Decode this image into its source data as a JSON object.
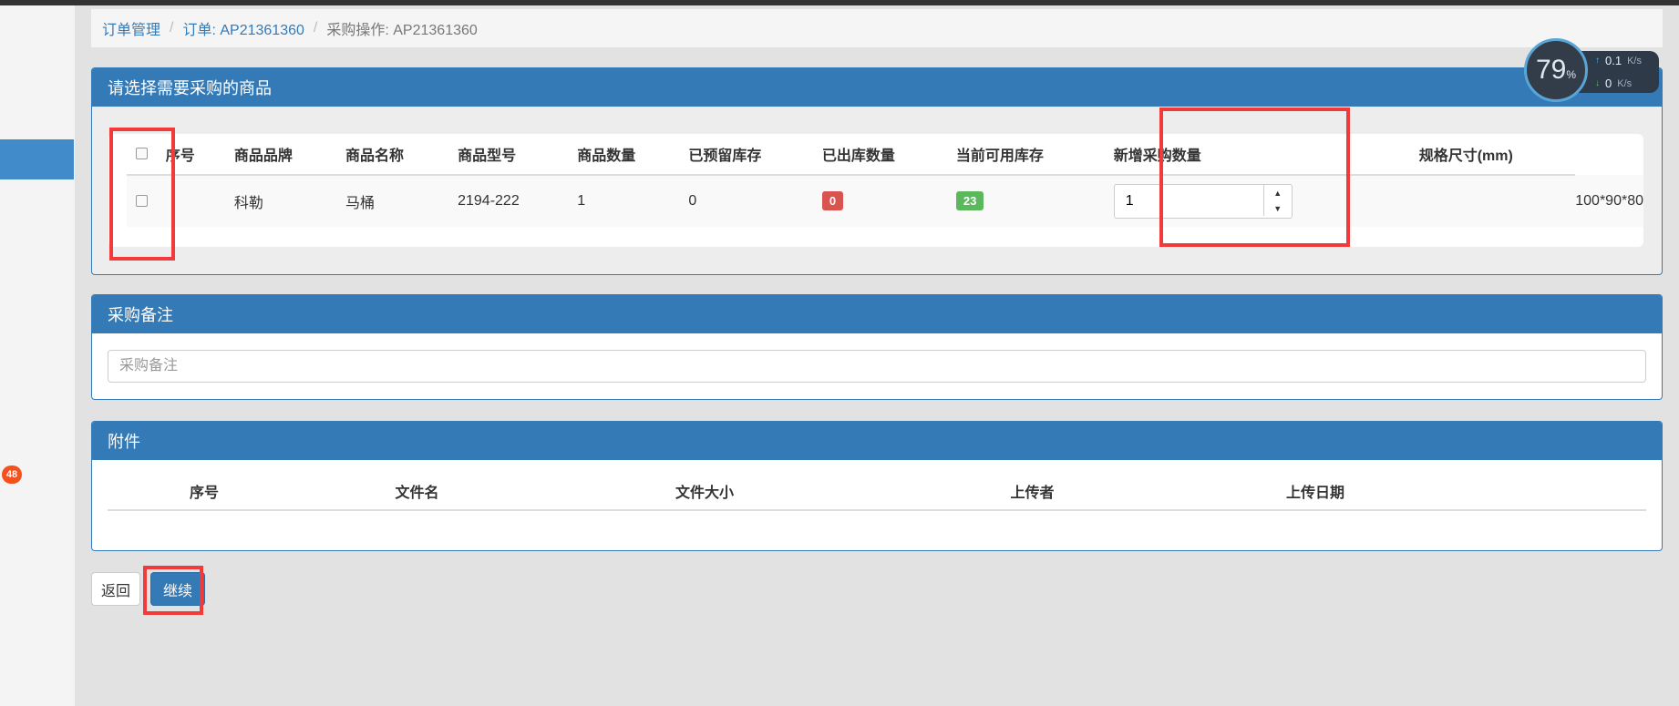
{
  "breadcrumb": {
    "items": [
      "订单管理",
      "订单: AP21361360"
    ],
    "separator": "/",
    "active": "采购操作: AP21361360"
  },
  "sidebar": {
    "badge": "48"
  },
  "goods_panel": {
    "title": "请选择需要采购的商品",
    "columns": [
      "序号",
      "商品品牌",
      "商品名称",
      "商品型号",
      "商品数量",
      "已预留库存",
      "已出库数量",
      "当前可用库存",
      "新增采购数量",
      "规格尺寸(mm)"
    ],
    "row": {
      "index": "",
      "brand": "科勒",
      "name": "马桶",
      "model": "2194-222",
      "quantity": "1",
      "reserved": "0",
      "shipped": "0",
      "available": "23",
      "new_purchase_qty": "1",
      "size": "100*90*80"
    }
  },
  "note_panel": {
    "title": "采购备注",
    "placeholder": "采购备注"
  },
  "attachments_panel": {
    "title": "附件",
    "columns": [
      "序号",
      "文件名",
      "文件大小",
      "上传者",
      "上传日期"
    ]
  },
  "buttons": {
    "back": "返回",
    "continue": "继续"
  },
  "monitor": {
    "percent": "79",
    "percent_unit": "%",
    "up_speed": "0.1",
    "down_speed": "0",
    "unit": "K/s"
  },
  "colors": {
    "primary": "#337ab7",
    "danger": "#d9534f",
    "success": "#5cb85c",
    "highlight": "#f23a3a"
  }
}
